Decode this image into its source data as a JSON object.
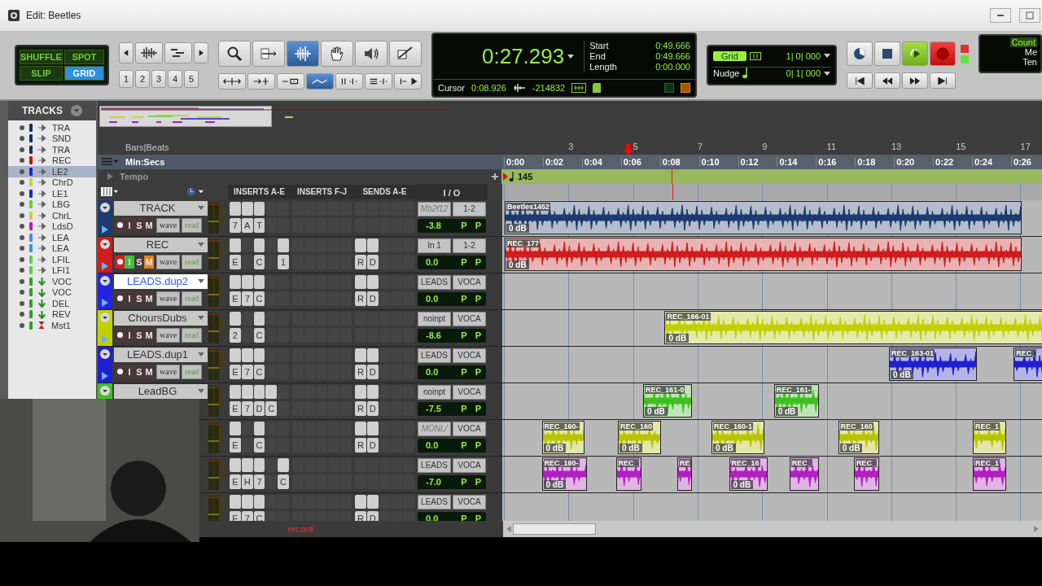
{
  "window": {
    "title": "Edit: Beetles"
  },
  "edit_modes": [
    {
      "label": "SHUFFLE",
      "selected": false
    },
    {
      "label": "SPOT",
      "selected": false
    },
    {
      "label": "SLIP",
      "selected": false
    },
    {
      "label": "GRID",
      "selected": true
    }
  ],
  "zoom_presets": [
    "1",
    "2",
    "3",
    "4",
    "5"
  ],
  "tools": [
    {
      "kind": "zoom",
      "selected": false
    },
    {
      "kind": "trim",
      "selected": false
    },
    {
      "kind": "select",
      "selected": true
    },
    {
      "kind": "grab",
      "selected": false
    },
    {
      "kind": "scrub",
      "selected": false
    },
    {
      "kind": "pencil",
      "selected": false
    }
  ],
  "toggles": [
    {
      "kind": "spread",
      "on": false
    },
    {
      "kind": "insert",
      "on": false
    },
    {
      "kind": "link",
      "on": false
    },
    {
      "kind": "automation",
      "on": true
    },
    {
      "kind": "heights",
      "on": false
    },
    {
      "kind": "lanes",
      "on": false
    },
    {
      "kind": "skip",
      "on": false
    }
  ],
  "counter": {
    "main": "0:27.293",
    "rows": [
      {
        "label": "Start",
        "value": "0:49.666"
      },
      {
        "label": "End",
        "value": "0:49.666"
      },
      {
        "label": "Length",
        "value": "0:00.000"
      }
    ],
    "cursor_label": "Cursor",
    "cursor_value": "0:08.926",
    "sample_value": "-214832"
  },
  "grid": {
    "label": "Grid",
    "value": "1| 0| 000"
  },
  "nudge": {
    "label": "Nudge",
    "value": "0| 1| 000"
  },
  "transport": [
    {
      "kind": "online"
    },
    {
      "kind": "stop"
    },
    {
      "kind": "play"
    },
    {
      "kind": "record"
    }
  ],
  "transport_nav": [
    {
      "kind": "start"
    },
    {
      "kind": "rewind"
    },
    {
      "kind": "forward"
    },
    {
      "kind": "end"
    }
  ],
  "count_panel": {
    "lines": [
      "Count",
      "Me",
      "Ten"
    ]
  },
  "tracks_list": {
    "title": "TRACKS",
    "items": [
      {
        "name": "TRA",
        "color": "#1a2f5a",
        "kind": "audio",
        "selected": false
      },
      {
        "name": "SND",
        "color": "#1a2f5a",
        "kind": "audio",
        "selected": false
      },
      {
        "name": "TRA",
        "color": "#1a2f5a",
        "kind": "audio",
        "selected": false
      },
      {
        "name": "REC",
        "color": "#c01818",
        "kind": "audio",
        "selected": false
      },
      {
        "name": "LE2",
        "color": "#2222d0",
        "kind": "audio",
        "selected": true
      },
      {
        "name": "ChrD",
        "color": "#c8d040",
        "kind": "audio",
        "selected": false
      },
      {
        "name": "LE1",
        "color": "#2222d0",
        "kind": "audio",
        "selected": false
      },
      {
        "name": "LBG",
        "color": "#60d040",
        "kind": "audio",
        "selected": false
      },
      {
        "name": "ChrL",
        "color": "#c8d040",
        "kind": "audio",
        "selected": false
      },
      {
        "name": "LdsD",
        "color": "#b020c0",
        "kind": "audio",
        "selected": false
      },
      {
        "name": "LEA",
        "color": "#4090e0",
        "kind": "audio",
        "selected": false
      },
      {
        "name": "LEA",
        "color": "#4090e0",
        "kind": "audio",
        "selected": false
      },
      {
        "name": "LFIL",
        "color": "#60d040",
        "kind": "audio",
        "selected": false
      },
      {
        "name": "LFI1",
        "color": "#60d040",
        "kind": "audio",
        "selected": false
      },
      {
        "name": "VOC",
        "color": "#30a030",
        "kind": "aux",
        "selected": false
      },
      {
        "name": "VOC",
        "color": "#30a030",
        "kind": "aux",
        "selected": false
      },
      {
        "name": "DEL",
        "color": "#30a030",
        "kind": "aux",
        "selected": false
      },
      {
        "name": "REV",
        "color": "#30a030",
        "kind": "aux",
        "selected": false
      },
      {
        "name": "Mst1",
        "color": "#30a030",
        "kind": "master",
        "selected": false
      }
    ]
  },
  "rulers": {
    "bars_label": "Bars|Beats",
    "bars": [
      "3",
      "5",
      "7",
      "9",
      "11",
      "13",
      "15",
      "17"
    ],
    "time_label": "Min:Secs",
    "times": [
      "0:00",
      "0:02",
      "0:04",
      "0:06",
      "0:08",
      "0:10",
      "0:12",
      "0:14",
      "0:16",
      "0:18",
      "0:20",
      "0:22",
      "0:24",
      "0:26"
    ],
    "tempo_label": "Tempo",
    "tempo": "145"
  },
  "columns": [
    "INSERTS A-E",
    "INSERTS F-J",
    "SENDS A-E",
    "I / O"
  ],
  "tracks": [
    {
      "name": "TRACK",
      "color": "#1d3b6e",
      "selected": false,
      "rec_armed": false,
      "buttons": [
        {
          "label": "I",
          "on": false
        },
        {
          "label": "S",
          "on": false
        },
        {
          "label": "M",
          "on": false
        }
      ],
      "view": "wave",
      "automation": "read",
      "inserts": [
        {
          "label": "7",
          "active": true
        },
        {
          "label": "A",
          "active": true
        },
        {
          "label": "T",
          "active": true
        },
        {
          "active": false
        },
        {
          "active": false
        }
      ],
      "input": "Mb2f12",
      "input_active": false,
      "output": "1-2",
      "volume": "-3.8",
      "pan": [
        "P",
        "P"
      ],
      "clips": [
        {
          "name": "Beetles1452",
          "gain": "0 dB"
        }
      ]
    },
    {
      "name": "REC",
      "color": "#d01c1c",
      "selected": false,
      "rec_armed": true,
      "buttons": [
        {
          "label": "I",
          "on": true
        },
        {
          "label": "S",
          "on": false
        },
        {
          "label": "M",
          "on": true
        }
      ],
      "view": "wave",
      "automation": "read",
      "inserts": [
        {
          "label": "E",
          "active": true
        },
        {
          "active": false
        },
        {
          "label": "C",
          "active": true
        },
        {
          "active": false
        },
        {
          "label": "1",
          "active": true
        }
      ],
      "sends": [
        {
          "label": "R",
          "active": true
        },
        {
          "label": "D",
          "active": true
        }
      ],
      "input": "In 1",
      "input_active": true,
      "output": "1-2",
      "volume": "0.0",
      "pan": [
        "P",
        "P"
      ],
      "clips": [
        {
          "name": "REC_177",
          "gain": "0 dB"
        }
      ]
    },
    {
      "name": "LEADS.dup2",
      "color": "#2424e0",
      "selected": true,
      "rec_armed": false,
      "buttons": [
        {
          "label": "I",
          "on": false
        },
        {
          "label": "S",
          "on": false
        },
        {
          "label": "M",
          "on": false
        }
      ],
      "view": "wave",
      "automation": "read",
      "inserts": [
        {
          "label": "E",
          "active": true
        },
        {
          "label": "7",
          "active": true
        },
        {
          "label": "C",
          "active": true
        },
        {
          "active": false
        },
        {
          "active": false
        }
      ],
      "sends": [
        {
          "label": "R",
          "active": true
        },
        {
          "label": "D",
          "active": true
        }
      ],
      "input": "LEADS",
      "input_active": true,
      "output": "VOCA",
      "volume": "0.0",
      "pan": [
        "P",
        "P"
      ]
    },
    {
      "name": "ChoursDubs",
      "color": "#c0d000",
      "selected": false,
      "rec_armed": false,
      "buttons": [
        {
          "label": "I",
          "on": false
        },
        {
          "label": "S",
          "on": false
        },
        {
          "label": "M",
          "on": false
        }
      ],
      "view": "wave",
      "automation": "read",
      "inserts": [
        {
          "label": "2",
          "active": true
        },
        {
          "active": false
        },
        {
          "label": "C",
          "active": true
        },
        {
          "active": false
        },
        {
          "active": false
        }
      ],
      "input": "noinpt",
      "input_active": true,
      "output": "VOCA",
      "volume": "-8.6",
      "pan": [
        "P",
        "P"
      ],
      "clips": [
        {
          "name": "REC_166-01",
          "gain": "0 dB"
        }
      ]
    },
    {
      "name": "LEADS.dup1",
      "color": "#2020d0",
      "selected": false,
      "rec_armed": false,
      "buttons": [
        {
          "label": "I",
          "on": false
        },
        {
          "label": "S",
          "on": false
        },
        {
          "label": "M",
          "on": false
        }
      ],
      "view": "wave",
      "automation": "read",
      "inserts": [
        {
          "label": "E",
          "active": true
        },
        {
          "label": "7",
          "active": true
        },
        {
          "label": "C",
          "active": true
        },
        {
          "active": false
        },
        {
          "active": false
        }
      ],
      "sends": [
        {
          "label": "R",
          "active": true
        },
        {
          "label": "D",
          "active": true
        }
      ],
      "input": "LEADS",
      "input_active": true,
      "output": "VOCA",
      "volume": "0.0",
      "pan": [
        "P",
        "P"
      ],
      "clips": [
        {
          "name": "REC_163-01",
          "gain": "0 dB"
        },
        {
          "name": "REC_"
        }
      ]
    },
    {
      "name": "LeadBG",
      "color": "#40c020",
      "selected": false,
      "inserts": [
        {
          "label": "E",
          "active": true
        },
        {
          "label": "7",
          "active": true
        },
        {
          "label": "D",
          "active": true
        },
        {
          "label": "C",
          "active": true
        },
        {
          "active": false
        }
      ],
      "sends": [
        {
          "label": "R",
          "active": true
        },
        {
          "label": "D",
          "active": true
        }
      ],
      "input": "noinpt",
      "input_active": true,
      "output": "VOCA",
      "volume": "-7.5",
      "pan": [
        "P",
        "P"
      ],
      "clips": [
        {
          "name": "REC_161-0",
          "gain": "0 dB"
        },
        {
          "name": "REC_161-",
          "gain": "0 dB"
        }
      ]
    },
    {
      "color": "#b8c400",
      "inserts": [
        {
          "label": "E",
          "active": true
        },
        {
          "active": false
        },
        {
          "label": "C",
          "active": true
        },
        {
          "active": false
        },
        {
          "active": false
        }
      ],
      "sends": [
        {
          "label": "R",
          "active": true
        },
        {
          "label": "D",
          "active": true
        }
      ],
      "input": "MONL/",
      "input_active": false,
      "output": "VOCA",
      "volume": "0.0",
      "pan": [
        "P",
        "P"
      ],
      "clips": [
        {
          "name": "REC_160-",
          "gain": "0 dB"
        },
        {
          "name": "REC_160",
          "gain": "0 dB"
        },
        {
          "name": "REC_160-1",
          "gain": "0 dB"
        },
        {
          "name": "REC_160",
          "gain": "0 dB"
        },
        {
          "name": "REC_1"
        }
      ]
    },
    {
      "color": "#b020c0",
      "inserts": [
        {
          "label": "E",
          "active": true
        },
        {
          "label": "H",
          "active": true
        },
        {
          "label": "7",
          "active": true
        },
        {
          "active": false
        },
        {
          "label": "C",
          "active": true
        }
      ],
      "input": "LEADS",
      "input_active": true,
      "output": "VOCA",
      "volume": "-7.0",
      "pan": [
        "P",
        "P"
      ],
      "clips": [
        {
          "name": "REC_160-",
          "gain": "0 dB"
        },
        {
          "name": "REC_"
        },
        {
          "name": "RE"
        },
        {
          "name": "REC_16",
          "gain": "0 dB"
        },
        {
          "name": "REC_"
        },
        {
          "name": "REC_"
        },
        {
          "name": "REC_1"
        }
      ]
    },
    {
      "inserts": [
        {
          "label": "E",
          "active": true
        },
        {
          "label": "7",
          "active": true
        },
        {
          "label": "C",
          "active": true
        },
        {
          "active": false
        },
        {
          "active": false
        }
      ],
      "sends": [
        {
          "label": "R",
          "active": true
        },
        {
          "label": "D",
          "active": true
        }
      ],
      "input": "LEADS",
      "input_active": true,
      "output": "VOCA",
      "volume": "0.0",
      "pan": [
        "P",
        "P"
      ]
    }
  ],
  "status_bar": {
    "mode_text": "record"
  }
}
